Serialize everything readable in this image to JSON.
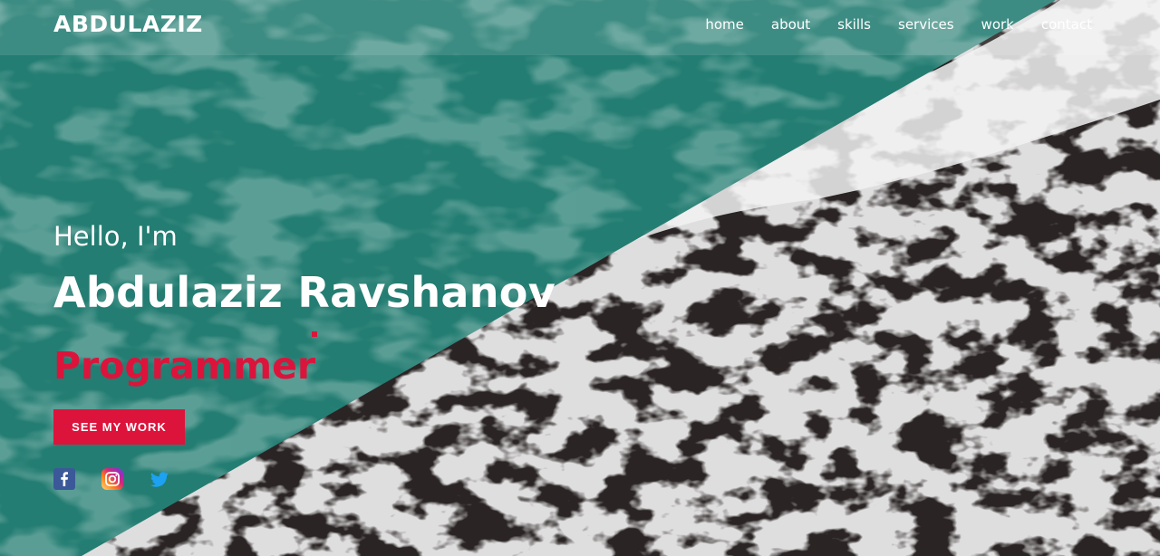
{
  "nav": {
    "logo": "ABDULAZIZ",
    "links": [
      "home",
      "about",
      "skills",
      "services",
      "work",
      "contact"
    ]
  },
  "hero": {
    "greeting": "Hello, I'm",
    "name": "Abdulaziz Ravshanov",
    "role": "Programmer",
    "cta_label": "SEE MY WORK"
  },
  "social": {
    "icons": [
      "facebook-icon",
      "instagram-icon",
      "twitter-icon"
    ]
  },
  "colors": {
    "teal_overlay": "#237d72",
    "accent": "#dc143c",
    "ocean_dark": "#2a2424"
  }
}
